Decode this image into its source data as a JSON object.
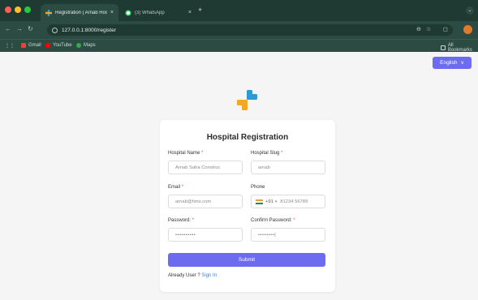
{
  "browser": {
    "tabs": [
      {
        "label": "Registration | Arnab Hospital",
        "close": "×"
      },
      {
        "label": "(3) WhatsApp",
        "close": "×"
      }
    ],
    "new_tab": "+",
    "url": "127.0.0.1:8000/register",
    "bookmarks": [
      "Gmail",
      "YouTube",
      "Maps"
    ],
    "all_bookmarks": "All Bookmarks"
  },
  "page": {
    "language": "English",
    "title": "Hospital Registration",
    "fields": {
      "hospital_name": {
        "label": "Hospital Name",
        "value": "Arnab Saha Construc"
      },
      "hospital_slug": {
        "label": "Hospital Slug",
        "value": "arnab"
      },
      "email": {
        "label": "Email",
        "value": "arnab@hms.com"
      },
      "phone": {
        "label": "Phone",
        "code": "+91",
        "placeholder": "81234 56789"
      },
      "password": {
        "label": "Password:",
        "value": "••••••••••"
      },
      "confirm_password": {
        "label": "Confirm Password:",
        "value": "••••••••|"
      }
    },
    "required_mark": "*",
    "submit": "Submit",
    "already_user": "Already User ?",
    "sign_in": "Sign In"
  },
  "colors": {
    "accent": "#6d6cf0",
    "chrome_dark": "#1f3a33",
    "chrome": "#2c4b43",
    "link": "#3a86d4",
    "logo_blue": "#2a9bd7",
    "logo_orange": "#f5a623"
  },
  "icons": [
    "info-icon",
    "star-icon",
    "extensions-icon",
    "medical-cross-logo",
    "chevron-down-icon",
    "india-flag-icon"
  ]
}
